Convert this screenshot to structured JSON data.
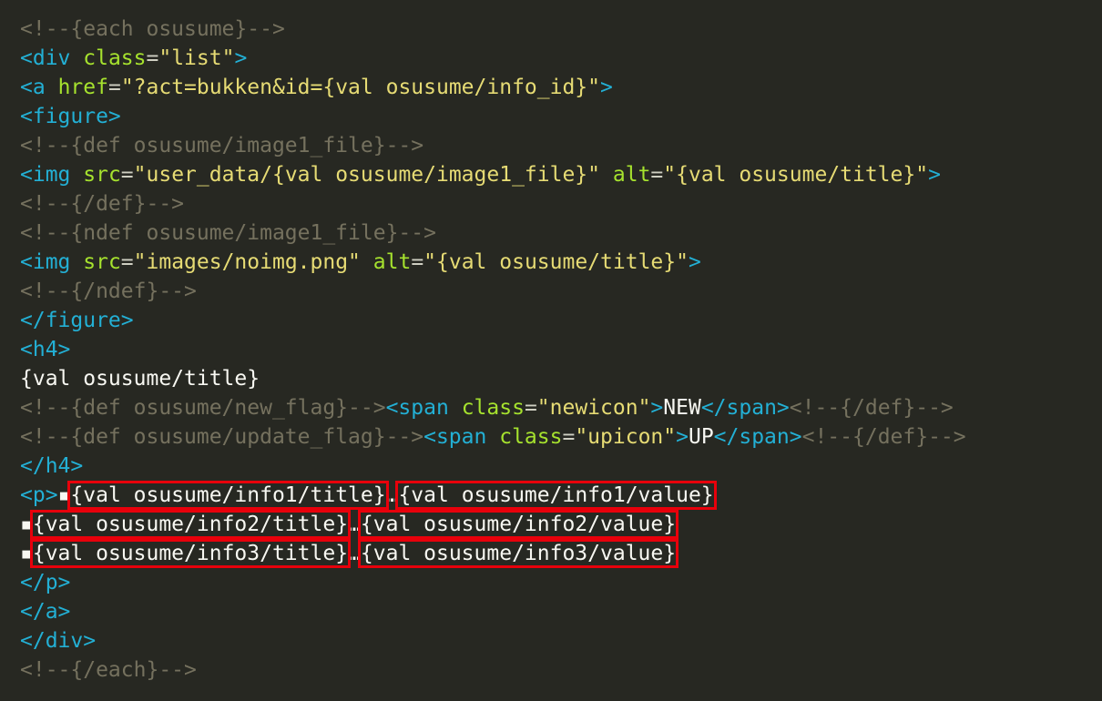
{
  "colors": {
    "background": "#272822",
    "comment": "#75715e",
    "tag": "#23b0d5",
    "attribute": "#a6e22e",
    "string": "#e6db74",
    "text": "#f8f8f2",
    "highlight_box": "#e8000b"
  },
  "code": {
    "l1": {
      "comment": "<!--{each osusume}-->"
    },
    "l2": {
      "open": "<div",
      "attr": "class",
      "eq": "=",
      "value": "\"list\"",
      "close": ">"
    },
    "l3": {
      "open": "<a",
      "attr": "href",
      "eq": "=",
      "value": "\"?act=bukken&id={val osusume/info_id}\"",
      "close": ">"
    },
    "l4": {
      "tag": "<figure>"
    },
    "l5": {
      "comment": "<!--{def osusume/image1_file}-->"
    },
    "l6": {
      "open": "<img",
      "attr1": "src",
      "eq1": "=",
      "value1": "\"user_data/{val osusume/image1_file}\"",
      "attr2": "alt",
      "eq2": "=",
      "value2": "\"{val osusume/title}\"",
      "close": ">"
    },
    "l7": {
      "comment": "<!--{/def}-->"
    },
    "l8": {
      "comment": "<!--{ndef osusume/image1_file}-->"
    },
    "l9": {
      "open": "<img",
      "attr1": "src",
      "eq1": "=",
      "value1": "\"images/noimg.png\"",
      "attr2": "alt",
      "eq2": "=",
      "value2": "\"{val osusume/title}\"",
      "close": ">"
    },
    "l10": {
      "comment": "<!--{/ndef}-->"
    },
    "l11": {
      "tag": "</figure>"
    },
    "l12": {
      "tag": "<h4>"
    },
    "l13": {
      "text": "{val osusume/title}"
    },
    "l14": {
      "comment1": "<!--{def osusume/new_flag}-->",
      "open": "<span",
      "attr": "class",
      "eq": "=",
      "value": "\"newicon\"",
      "close": ">",
      "text": "NEW",
      "end": "</span>",
      "comment2": "<!--{/def}-->"
    },
    "l15": {
      "comment1": "<!--{def osusume/update_flag}-->",
      "open": "<span",
      "attr": "class",
      "eq": "=",
      "value": "\"upicon\"",
      "close": ">",
      "text": "UP",
      "end": "</span>",
      "comment2": "<!--{/def}-->"
    },
    "l16": {
      "tag": "</h4>"
    },
    "l17": {
      "tag": "<p>",
      "bullet": "▪",
      "title": "{val osusume/info1/title}",
      "sep": "…",
      "value": "{val osusume/info1/value}"
    },
    "l18": {
      "bullet": "▪",
      "title": "{val osusume/info2/title}",
      "sep": "…",
      "value": "{val osusume/info2/value}"
    },
    "l19": {
      "bullet": "▪",
      "title": "{val osusume/info3/title}",
      "sep": "…",
      "value": "{val osusume/info3/value}"
    },
    "l20": {
      "tag": "</p>"
    },
    "l21": {
      "tag": "</a>"
    },
    "l22": {
      "tag": "</div>"
    },
    "l23": {
      "comment": "<!--{/each}-->"
    }
  }
}
